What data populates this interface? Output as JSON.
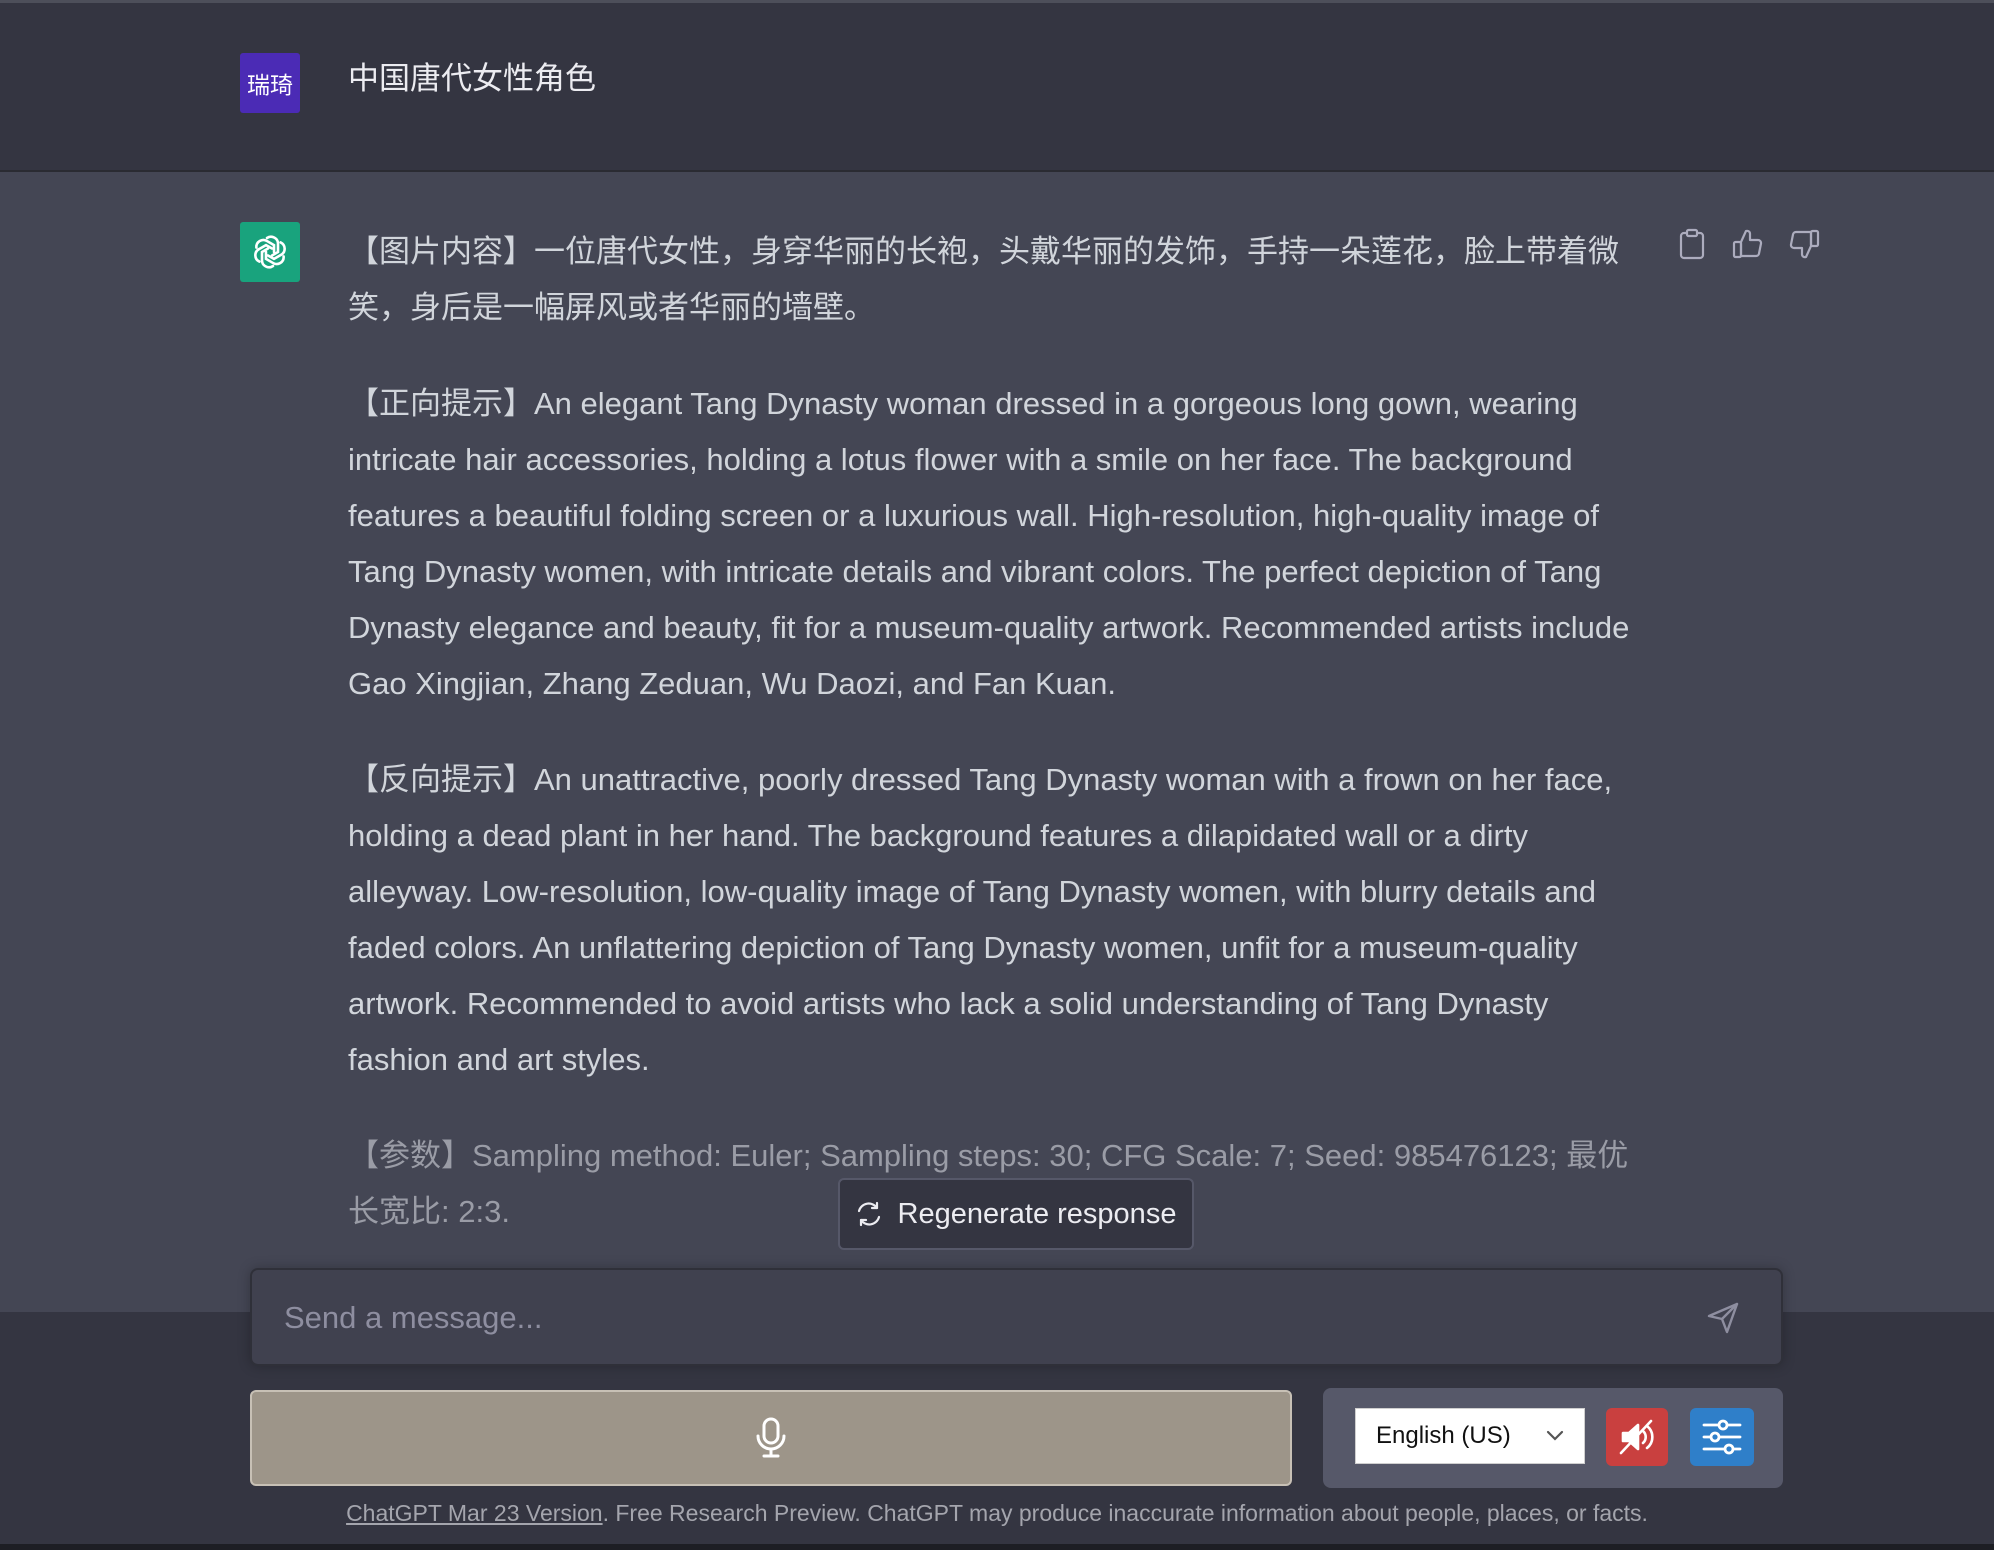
{
  "conversation": {
    "user_avatar_text": "瑞琦",
    "user_message": "中国唐代女性角色",
    "assistant": {
      "paragraphs": [
        "【图片内容】一位唐代女性，身穿华丽的长袍，头戴华丽的发饰，手持一朵莲花，脸上带着微笑，身后是一幅屏风或者华丽的墙壁。",
        "【正向提示】An elegant Tang Dynasty woman dressed in a gorgeous long gown, wearing intricate hair accessories, holding a lotus flower with a smile on her face. The background features a beautiful folding screen or a luxurious wall. High-resolution, high-quality image of Tang Dynasty women, with intricate details and vibrant colors. The perfect depiction of Tang Dynasty elegance and beauty, fit for a museum-quality artwork. Recommended artists include Gao Xingjian, Zhang Zeduan, Wu Daozi, and Fan Kuan.",
        "【反向提示】An unattractive, poorly dressed Tang Dynasty woman with a frown on her face, holding a dead plant in her hand. The background features a dilapidated wall or a dirty alleyway. Low-resolution, low-quality image of Tang Dynasty women, with blurry details and faded colors. An unflattering depiction of Tang Dynasty women, unfit for a museum-quality artwork. Recommended to avoid artists who lack a solid understanding of Tang Dynasty fashion and art styles.",
        "【参数】Sampling method: Euler; Sampling steps: 30; CFG Scale: 7; Seed: 985476123; 最优长宽比: 2:3."
      ],
      "action_icons": [
        "clipboard-icon",
        "thumbs-up-icon",
        "thumbs-down-icon"
      ]
    }
  },
  "regenerate": {
    "label": "Regenerate response",
    "icon": "refresh-icon"
  },
  "input": {
    "placeholder": "Send a message...",
    "value": ""
  },
  "voice": {
    "mic_icon": "microphone-icon",
    "language": "English (US)",
    "mute_icon": "speaker-muted-icon",
    "settings_icon": "sliders-icon"
  },
  "footer": {
    "link": "ChatGPT Mar 23 Version",
    "text": ". Free Research Preview. ChatGPT may produce inaccurate information about people, places, or facts."
  },
  "colors": {
    "background_user": "#343541",
    "background_assistant": "#444654",
    "user_avatar": "#4b2bb5",
    "gpt_avatar": "#19a37d",
    "mic_button": "#9d9589",
    "mute_button": "#c9403f",
    "settings_button": "#2f7fc9"
  }
}
